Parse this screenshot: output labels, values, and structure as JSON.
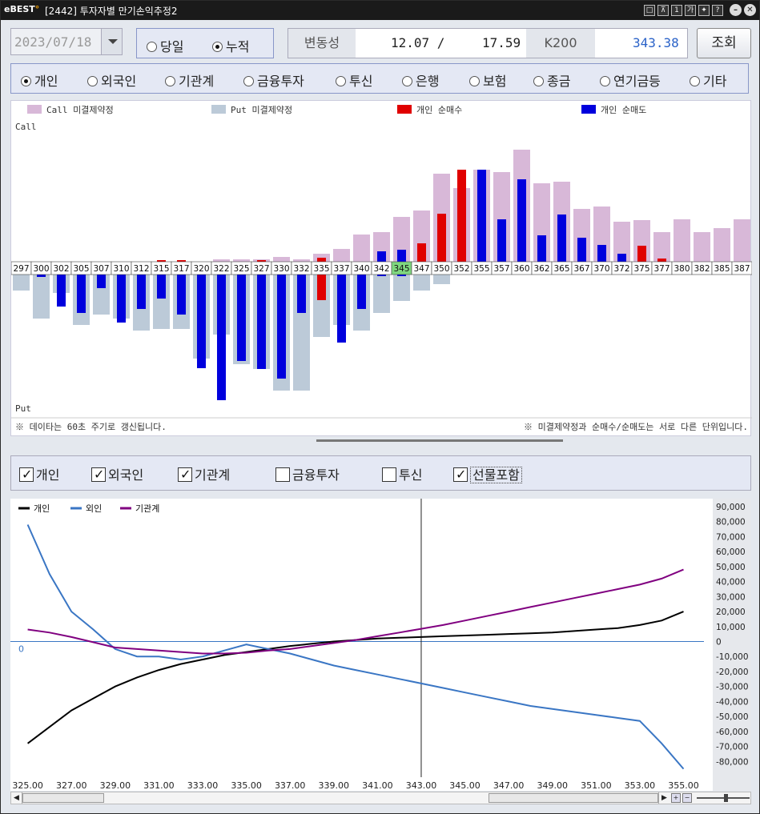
{
  "titlebar": {
    "logo_prefix": "e",
    "logo_text": "BEST",
    "title": "[2442] 투자자별 만기손익추정2",
    "buttons": [
      "□",
      "⊼",
      "1",
      "가",
      "✦",
      "?"
    ],
    "min": "–",
    "close": "✕"
  },
  "controls": {
    "date": "2023/07/18",
    "period_options": [
      {
        "label": "당일",
        "selected": false
      },
      {
        "label": "누적",
        "selected": true
      }
    ],
    "volatility_label": "변동성",
    "volatility_value": "12.07 /",
    "volatility_value2": "17.59",
    "k200_label": "K200",
    "k200_value": "343.38",
    "query_button": "조회"
  },
  "investors": [
    {
      "label": "개인",
      "selected": true
    },
    {
      "label": "외국인",
      "selected": false
    },
    {
      "label": "기관계",
      "selected": false
    },
    {
      "label": "금융투자",
      "selected": false
    },
    {
      "label": "투신",
      "selected": false
    },
    {
      "label": "은행",
      "selected": false
    },
    {
      "label": "보험",
      "selected": false
    },
    {
      "label": "종금",
      "selected": false
    },
    {
      "label": "연기금등",
      "selected": false
    },
    {
      "label": "기타",
      "selected": false
    }
  ],
  "chart_data": [
    {
      "type": "bar",
      "legend": [
        "Call 미결제약정",
        "Put 미결제약정",
        "개인 순매수",
        "개인 순매도"
      ],
      "colors": {
        "call_oi": "#d8b8d8",
        "put_oi": "#bccad8",
        "buy": "#e00000",
        "sell": "#0000dd",
        "highlight": "#7fd77f"
      },
      "top_label": "Call",
      "bottom_label": "Put",
      "categories": [
        "297",
        "300",
        "302",
        "305",
        "307",
        "310",
        "312",
        "315",
        "317",
        "320",
        "322",
        "325",
        "327",
        "330",
        "332",
        "335",
        "337",
        "340",
        "342",
        "345",
        "347",
        "350",
        "352",
        "355",
        "357",
        "360",
        "362",
        "365",
        "367",
        "370",
        "372",
        "375",
        "377",
        "380",
        "382",
        "385",
        "387"
      ],
      "highlight_category": "345",
      "call_oi": [
        0,
        0,
        0,
        0,
        0,
        0,
        0,
        0,
        0,
        0,
        3,
        3,
        3,
        6,
        3,
        10,
        16,
        34,
        37,
        56,
        64,
        110,
        92,
        115,
        112,
        140,
        98,
        100,
        66,
        69,
        50,
        52,
        37,
        53,
        37,
        42,
        53
      ],
      "call_individual": [
        0,
        0,
        0,
        0,
        0,
        0,
        0,
        2,
        2,
        0,
        0,
        0,
        2,
        0,
        0,
        5,
        0,
        0,
        13,
        15,
        23,
        60,
        115,
        115,
        53,
        103,
        33,
        59,
        30,
        21,
        10,
        20,
        4,
        0,
        0,
        0,
        0
      ],
      "put_oi": [
        -20,
        -55,
        -23,
        -63,
        -50,
        -55,
        -70,
        -68,
        -68,
        -105,
        -75,
        -112,
        -118,
        -145,
        -145,
        -78,
        -63,
        -70,
        -48,
        -33,
        -20,
        -12,
        0,
        0,
        0,
        0,
        0,
        0,
        0,
        0,
        0,
        0,
        0,
        0,
        0,
        0,
        0
      ],
      "put_individual": [
        0,
        -3,
        -40,
        -48,
        -17,
        -60,
        -43,
        -30,
        -50,
        -117,
        -157,
        -108,
        -118,
        -130,
        -48,
        -32,
        -85,
        -43,
        -2,
        -2,
        0,
        0,
        0,
        0,
        0,
        0,
        0,
        0,
        0,
        0,
        0,
        0,
        0,
        0,
        0,
        0,
        0
      ],
      "footer_left": "※ 데이타는 60초 주기로 갱신됩니다.",
      "footer_right": "※ 미결제약정과 순매수/순매도는 서로 다른 단위입니다."
    },
    {
      "type": "line",
      "series": [
        {
          "name": "개인",
          "color": "#000000",
          "x": [
            325,
            326,
            327,
            328,
            329,
            330,
            331,
            332,
            333,
            334,
            335,
            336,
            337,
            338,
            339,
            340,
            341,
            342,
            343,
            344,
            345,
            346,
            347,
            348,
            349,
            350,
            351,
            352,
            353,
            354,
            355
          ],
          "values": [
            -68000,
            -57000,
            -46000,
            -38000,
            -30000,
            -24000,
            -19000,
            -15000,
            -12000,
            -9000,
            -7000,
            -5000,
            -3000,
            -1500,
            0,
            1000,
            2000,
            2500,
            3000,
            3500,
            4000,
            4500,
            5000,
            5500,
            6000,
            7000,
            8000,
            9000,
            11000,
            14000,
            20000
          ]
        },
        {
          "name": "외인",
          "color": "#3a76c4",
          "x": [
            325,
            326,
            327,
            328,
            329,
            330,
            331,
            332,
            333,
            334,
            335,
            336,
            337,
            338,
            339,
            340,
            341,
            342,
            343,
            344,
            345,
            346,
            347,
            348,
            349,
            350,
            351,
            352,
            353,
            354,
            355
          ],
          "values": [
            78000,
            45000,
            20000,
            8000,
            -5000,
            -10000,
            -10000,
            -12000,
            -10000,
            -6000,
            -2000,
            -5000,
            -8000,
            -12000,
            -16000,
            -19000,
            -22000,
            -25000,
            -28000,
            -31000,
            -34000,
            -37000,
            -40000,
            -43000,
            -45000,
            -47000,
            -49000,
            -51000,
            -53000,
            -68000,
            -85000
          ]
        },
        {
          "name": "기관계",
          "color": "#800080",
          "x": [
            325,
            326,
            327,
            328,
            329,
            330,
            331,
            332,
            333,
            334,
            335,
            336,
            337,
            338,
            339,
            340,
            341,
            342,
            343,
            344,
            345,
            346,
            347,
            348,
            349,
            350,
            351,
            352,
            353,
            354,
            355
          ],
          "values": [
            8000,
            6000,
            3000,
            -500,
            -4000,
            -5000,
            -6000,
            -7000,
            -8000,
            -8000,
            -7500,
            -6000,
            -5000,
            -3000,
            -1000,
            1000,
            3500,
            6000,
            8500,
            11000,
            14000,
            17000,
            20000,
            23000,
            26000,
            29000,
            32000,
            35000,
            38000,
            42000,
            48000
          ]
        }
      ],
      "xticks": [
        "325.00",
        "327.00",
        "329.00",
        "331.00",
        "333.00",
        "335.00",
        "337.00",
        "339.00",
        "341.00",
        "343.00",
        "345.00",
        "347.00",
        "349.00",
        "351.00",
        "353.00",
        "355.00"
      ],
      "yticks": [
        "90,000",
        "80,000",
        "70,000",
        "60,000",
        "50,000",
        "40,000",
        "30,000",
        "20,000",
        "10,000",
        "0",
        "-10,000",
        "-20,000",
        "-30,000",
        "-40,000",
        "-50,000",
        "-60,000",
        "-70,000",
        "-80,000"
      ],
      "zero_label": "0",
      "ylim": [
        -90000,
        90000
      ],
      "xlim": [
        324.5,
        356.3
      ],
      "crosshair_x": 343.0
    }
  ],
  "filters": [
    {
      "label": "개인",
      "checked": true
    },
    {
      "label": "외국인",
      "checked": true
    },
    {
      "label": "기관계",
      "checked": true
    },
    {
      "label": "금융투자",
      "checked": false
    },
    {
      "label": "투신",
      "checked": false
    },
    {
      "label": "선물포함",
      "checked": true
    }
  ]
}
